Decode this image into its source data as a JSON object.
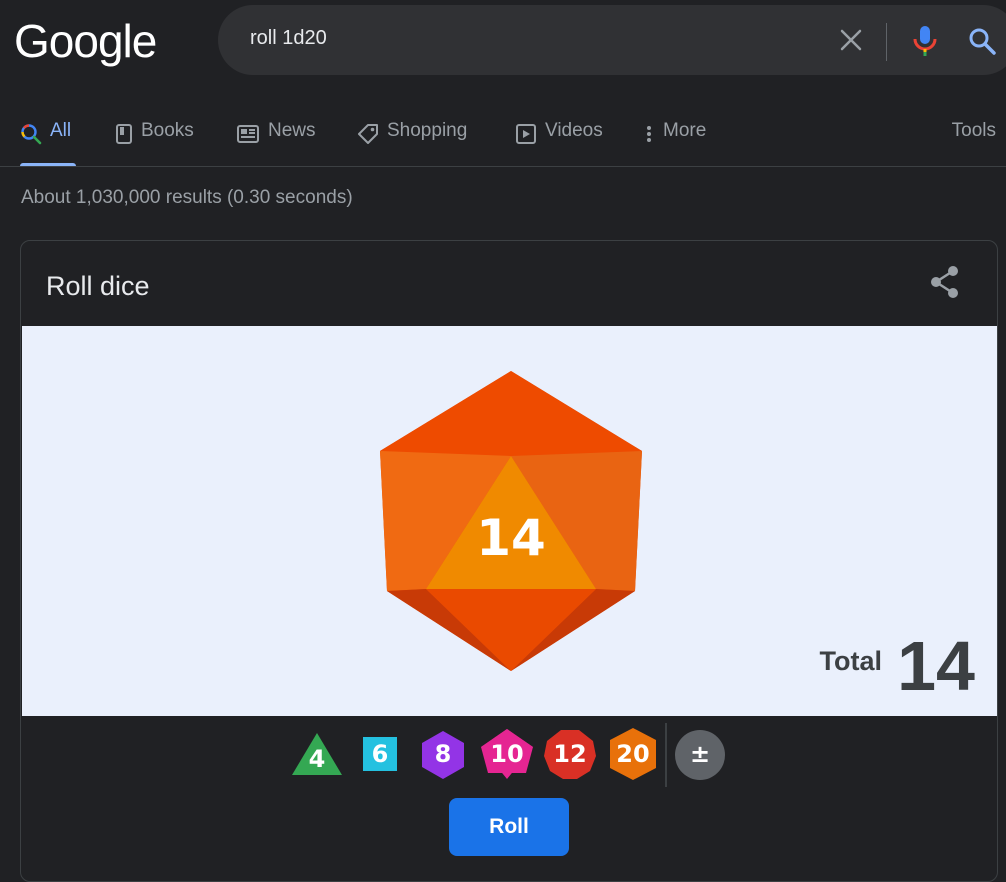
{
  "logo": "Google",
  "search": {
    "query": "roll 1d20"
  },
  "tabs": [
    {
      "label": "All",
      "icon": "search-icon",
      "active": true
    },
    {
      "label": "Books",
      "icon": "book-icon"
    },
    {
      "label": "News",
      "icon": "news-icon"
    },
    {
      "label": "Shopping",
      "icon": "tag-icon"
    },
    {
      "label": "Videos",
      "icon": "play-icon"
    },
    {
      "label": "More",
      "icon": "more-vert-icon"
    }
  ],
  "tools_label": "Tools",
  "result_stats": "About 1,030,000 results (0.30 seconds)",
  "card": {
    "title": "Roll dice",
    "die_value": "14",
    "total_label": "Total",
    "total_value": "14",
    "dice": [
      {
        "label": "4",
        "color": "#34a853"
      },
      {
        "label": "6",
        "color": "#24c1e0"
      },
      {
        "label": "8",
        "color": "#9334e6"
      },
      {
        "label": "10",
        "color": "#e52592"
      },
      {
        "label": "12",
        "color": "#d93025"
      },
      {
        "label": "20",
        "color": "#e8710a"
      },
      {
        "label": "±",
        "color": "#5f6368"
      }
    ],
    "roll_label": "Roll"
  },
  "colors": {
    "accent": "#8ab4f8",
    "roll_button": "#1a73e8",
    "die_main": "#e8710a"
  }
}
